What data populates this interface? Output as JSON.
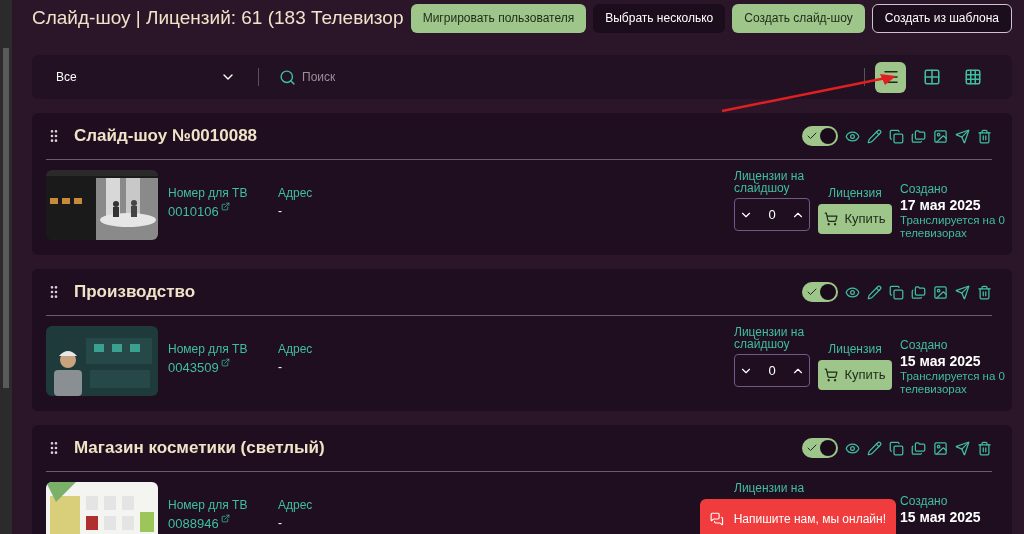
{
  "header": {
    "title": "Слайд-шоу | Лицензий: 61 (183 Телевизор",
    "buttons": [
      {
        "label": "Мигрировать пользователя",
        "kind": "primary"
      },
      {
        "label": "Выбрать несколько",
        "kind": "dark"
      },
      {
        "label": "Создать слайд-шоу",
        "kind": "primary"
      },
      {
        "label": "Создать из шаблона",
        "kind": "outline"
      }
    ]
  },
  "filter": {
    "value": "Все",
    "search_placeholder": "Поиск",
    "views": [
      {
        "kind": "list",
        "selected": true
      },
      {
        "kind": "compact",
        "selected": false
      },
      {
        "kind": "grid",
        "selected": false
      }
    ]
  },
  "slideshows": [
    {
      "title": "Слайд-шоу №0010088",
      "on": true,
      "tv_label": "Номер для ТВ",
      "tv_number": "0010106",
      "address_label": "Адрес",
      "address": "-",
      "licenses_label": "Лицензии на слайдшоу",
      "licenses_count": "0",
      "license_label": "Лицензия",
      "buy": "Купить",
      "created_label": "Создано",
      "created": "17 мая 2025",
      "broadcast": "Транслируется на 0 телевизорах"
    },
    {
      "title": "Производство",
      "on": true,
      "tv_label": "Номер для ТВ",
      "tv_number": "0043509",
      "address_label": "Адрес",
      "address": "-",
      "licenses_label": "Лицензии на слайдшоу",
      "licenses_count": "0",
      "license_label": "Лицензия",
      "buy": "Купить",
      "created_label": "Создано",
      "created": "15 мая 2025",
      "broadcast": "Транслируется на 0 телевизорах"
    },
    {
      "title": "Магазин косметики (светлый)",
      "on": true,
      "tv_label": "Номер для ТВ",
      "tv_number": "0088946",
      "address_label": "Адрес",
      "address": "-",
      "licenses_label": "Лицензии на",
      "created_label": "Создано",
      "created": "15 мая 2025"
    }
  ],
  "chat": {
    "label": "Напишите нам, мы онлайн!"
  }
}
